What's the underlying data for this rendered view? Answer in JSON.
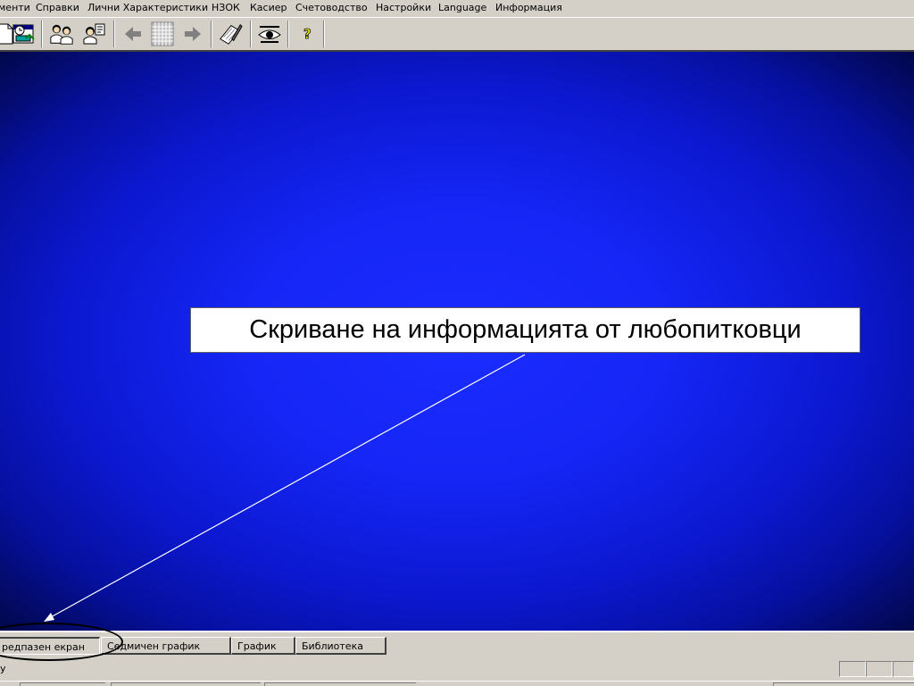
{
  "menu": {
    "items": [
      "менти",
      "Справки",
      "Лични Характеристики",
      "НЗОК",
      "Касиер",
      "Счетоводство",
      "Настройки",
      "Language",
      "Информация"
    ]
  },
  "toolbar": {
    "buttons": [
      {
        "icon": "document-icon"
      },
      {
        "icon": "schedule-icon"
      },
      {
        "icon": "patients-group-icon"
      },
      {
        "icon": "patient-edit-icon"
      },
      {
        "icon": "back-arrow-icon"
      },
      {
        "icon": "calendar-grid-icon"
      },
      {
        "icon": "forward-arrow-icon"
      },
      {
        "icon": "edit-pen-icon"
      },
      {
        "icon": "hide-eye-icon"
      },
      {
        "icon": "help-icon"
      }
    ]
  },
  "main": {
    "callout_text": "Скриване на информацията от любопитковци",
    "background_colors": {
      "center": "#1a2cff",
      "edge": "#000530"
    }
  },
  "tabs": [
    {
      "label": "редпазен екран",
      "active": true
    },
    {
      "label": "Седмичен график",
      "active": false
    },
    {
      "label": "График",
      "active": false
    },
    {
      "label": "Библиотека",
      "active": false
    }
  ],
  "status": {
    "text": "y"
  }
}
